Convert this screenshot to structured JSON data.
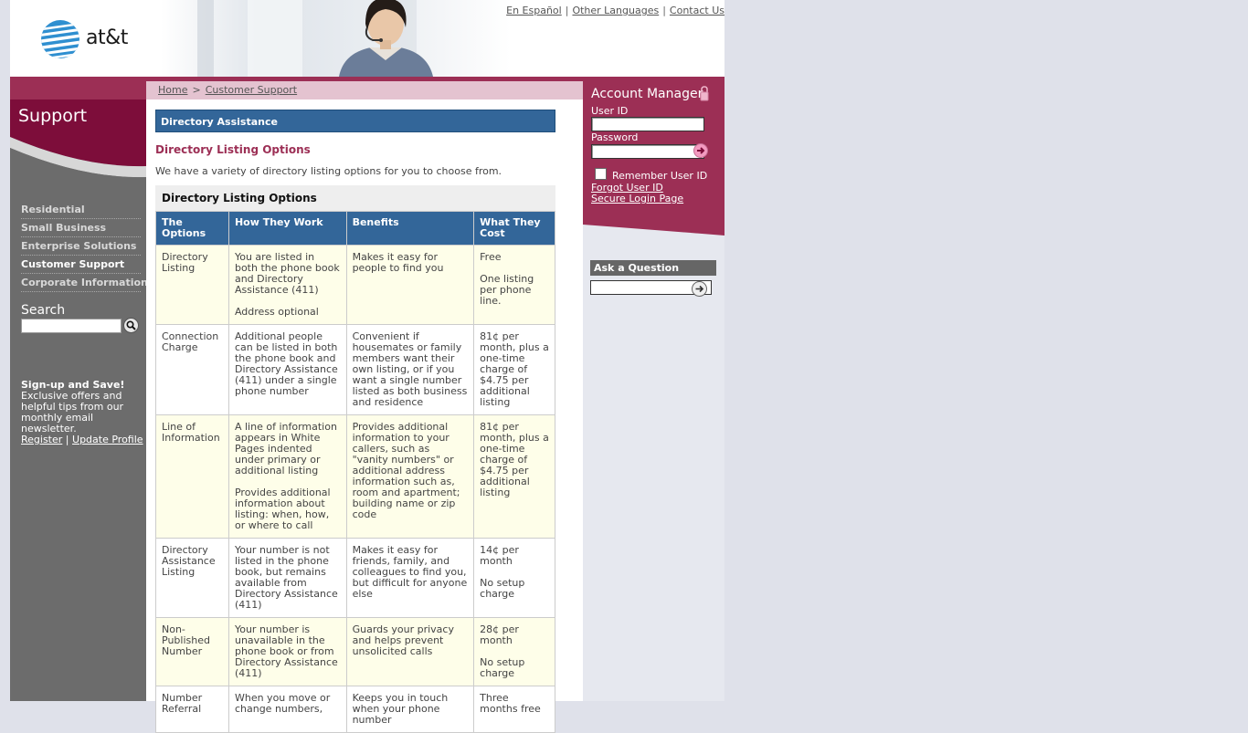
{
  "header": {
    "logo_text": "at&t",
    "links": [
      "En Español",
      "Other Languages",
      "Contact Us"
    ],
    "link_separator": "|"
  },
  "left_nav": {
    "title": "Support",
    "items": [
      {
        "label": "Residential",
        "active": false
      },
      {
        "label": "Small Business",
        "active": false
      },
      {
        "label": "Enterprise Solutions",
        "active": false
      },
      {
        "label": "Customer Support",
        "active": true
      },
      {
        "label": "Corporate Information",
        "active": false
      }
    ],
    "search_label": "Search",
    "signup": {
      "title": "Sign-up and Save!",
      "text": "Exclusive offers and helpful tips from our monthly email newsletter.",
      "register_link": "Register",
      "separator": "|",
      "update_link": "Update Profile"
    }
  },
  "breadcrumb": {
    "items": [
      "Home",
      "Customer Support"
    ],
    "separator": ">"
  },
  "main": {
    "section_title": "Directory Assistance",
    "heading": "Directory Listing Options",
    "intro": "We have a variety of directory listing options for you to choose from.",
    "table_title": "Directory Listing Options",
    "columns": [
      "The Options",
      "How They Work",
      "Benefits",
      "What They Cost"
    ],
    "rows": [
      {
        "option": "Directory Listing",
        "how": [
          "You are listed in both the phone book and Directory Assistance (411)",
          "Address optional"
        ],
        "benefits": [
          "Makes it easy for people to find you"
        ],
        "cost": [
          "Free",
          "One listing per phone line."
        ]
      },
      {
        "option": "Connection Charge",
        "how": [
          "Additional people can be listed in both the phone book and Directory Assistance (411) under a single phone number"
        ],
        "benefits": [
          "Convenient if housemates or family members want their own listing, or if you want a single number listed as both business and residence"
        ],
        "cost": [
          "81¢ per month, plus a one-time charge of $4.75 per additional listing"
        ]
      },
      {
        "option": "Line of Information",
        "how": [
          "A line of information appears in White Pages indented under primary or additional listing",
          "Provides additional information about listing: when, how, or where to call"
        ],
        "benefits": [
          "Provides additional information to your callers, such as \"vanity numbers\" or additional address information such as, room and apartment; building name or zip code"
        ],
        "cost": [
          "81¢ per month, plus a one-time charge of $4.75 per additional listing"
        ]
      },
      {
        "option": "Directory Assistance Listing",
        "how": [
          "Your number is not listed in the phone book, but remains available from Directory Assistance (411)"
        ],
        "benefits": [
          "Makes it easy for friends, family, and colleagues to find you, but difficult for anyone else"
        ],
        "cost": [
          "14¢ per month",
          "No setup charge"
        ]
      },
      {
        "option": "Non-Published Number",
        "how": [
          "Your number is unavailable in the phone book or from Directory Assistance (411)"
        ],
        "benefits": [
          "Guards your privacy and helps prevent unsolicited calls"
        ],
        "cost": [
          "28¢ per month",
          "No setup charge"
        ]
      },
      {
        "option": "Number Referral",
        "how": [
          "When you move or change numbers,"
        ],
        "benefits": [
          "Keeps you in touch when your phone number"
        ],
        "cost": [
          "Three months free"
        ]
      }
    ]
  },
  "account_manager": {
    "title": "Account Manager",
    "user_id_label": "User ID",
    "password_label": "Password",
    "remember_label": "Remember User ID",
    "forgot_link": "Forgot User ID",
    "secure_link": "Secure Login Page"
  },
  "ask": {
    "title": "Ask a Question"
  },
  "colors": {
    "brand_maroon": "#9c2f55",
    "table_header_blue": "#336699",
    "nav_gray": "#6c6c6c",
    "row_highlight": "#fefee9"
  }
}
